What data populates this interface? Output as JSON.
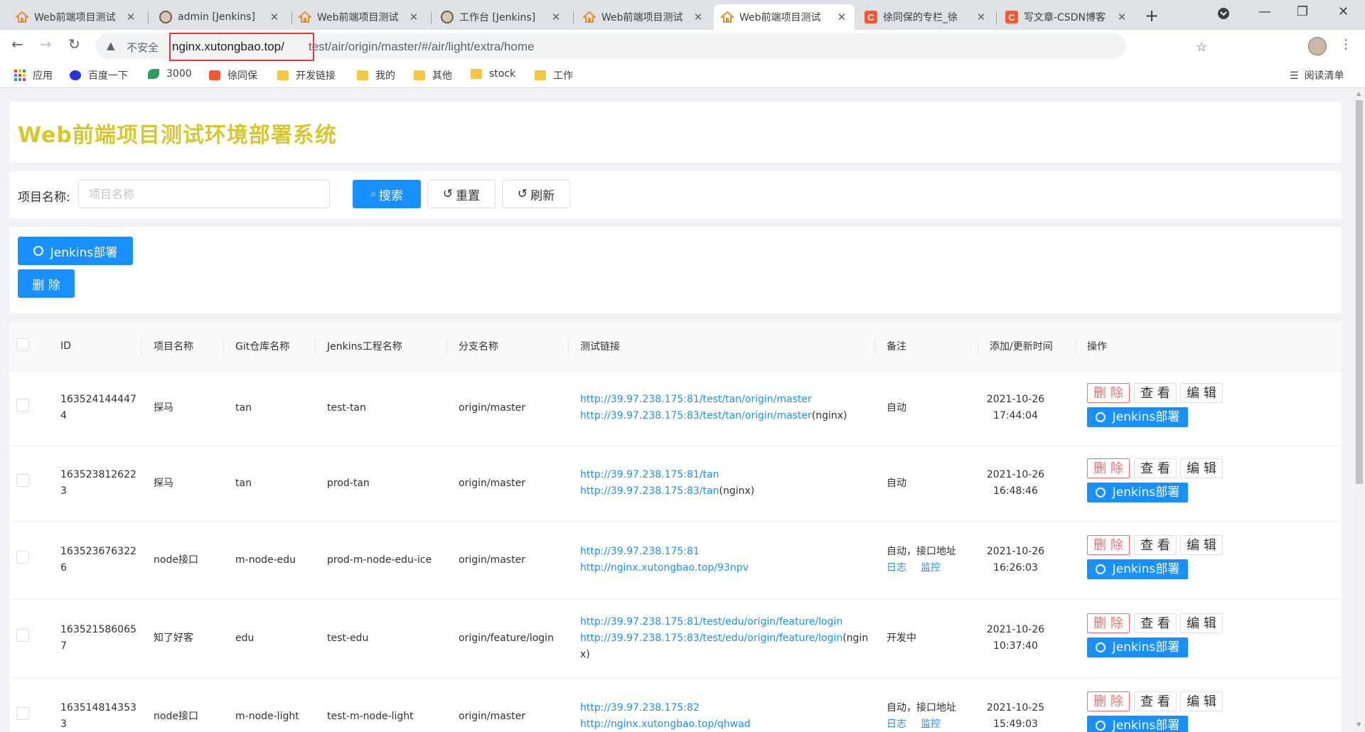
{
  "browser": {
    "tabs": [
      {
        "title": "Web前端项目测试",
        "icon": "web-project-icon",
        "active": false
      },
      {
        "title": "admin [Jenkins]",
        "icon": "jenkins-icon",
        "active": false
      },
      {
        "title": "Web前端项目测试",
        "icon": "web-project-icon",
        "active": false
      },
      {
        "title": "工作台 [Jenkins]",
        "icon": "jenkins-icon",
        "active": false
      },
      {
        "title": "Web前端项目测试",
        "icon": "web-project-icon",
        "active": false
      },
      {
        "title": "Web前端项目测试",
        "icon": "web-project-icon",
        "active": true
      },
      {
        "title": "徐同保的专栏_徐",
        "icon": "csdn-icon",
        "active": false
      },
      {
        "title": "写文章-CSDN博客",
        "icon": "csdn-icon",
        "active": false
      }
    ],
    "address": {
      "warning": "不安全",
      "host": "nginx.xutongbao.top/",
      "path": "test/air/origin/master/#/air/light/extra/home"
    },
    "bookmarks": [
      {
        "label": "应用",
        "icon": "apps-icon"
      },
      {
        "label": "百度一下",
        "icon": "baidu-icon"
      },
      {
        "label": "3000",
        "icon": "plant-icon"
      },
      {
        "label": "徐同保",
        "icon": "csdn-icon"
      },
      {
        "label": "开发链接",
        "icon": "folder-icon"
      },
      {
        "label": "我的",
        "icon": "folder-icon"
      },
      {
        "label": "其他",
        "icon": "folder-icon"
      },
      {
        "label": "stock",
        "icon": "folder-icon"
      },
      {
        "label": "工作",
        "icon": "folder-icon"
      }
    ],
    "reading_list": "阅读清单"
  },
  "page": {
    "title": "Web前端项目测试环境部署系统",
    "search": {
      "label": "项目名称:",
      "placeholder": "项目名称",
      "value": "",
      "search_btn": "搜索",
      "reset_btn": "重置",
      "refresh_btn": "刷新"
    },
    "actions": {
      "jenkins_btn": "Jenkins部署",
      "delete_btn": "删 除"
    },
    "table": {
      "columns": [
        "ID",
        "项目名称",
        "Git仓库名称",
        "Jenkins工程名称",
        "分支名称",
        "测试链接",
        "备注",
        "添加/更新时间",
        "操作"
      ],
      "rows": [
        {
          "id": "1635241444474",
          "project": "探马",
          "git": "tan",
          "jenkins": "test-tan",
          "branch": "origin/master",
          "link1": "http://39.97.238.175:81/test/tan/origin/master",
          "link2": "http://39.97.238.175:83/test/tan/origin/master",
          "link2_suffix": "(nginx)",
          "memo": "自动",
          "memo_links": [],
          "date": "2021-10-26",
          "time": "17:44:04"
        },
        {
          "id": "1635238126223",
          "project": "探马",
          "git": "tan",
          "jenkins": "prod-tan",
          "branch": "origin/master",
          "link1": "http://39.97.238.175:81/tan",
          "link2": "http://39.97.238.175:83/tan",
          "link2_suffix": "(nginx)",
          "memo": "自动",
          "memo_links": [],
          "date": "2021-10-26",
          "time": "16:48:46"
        },
        {
          "id": "1635236763226",
          "project": "node接口",
          "git": "m-node-edu",
          "jenkins": "prod-m-node-edu-ice",
          "branch": "origin/master",
          "link1": "http://39.97.238.175:81",
          "link2": "http://nginx.xutongbao.top/93npv",
          "link2_suffix": "",
          "memo": "自动，接口地址",
          "memo_links": [
            "日志",
            "监控"
          ],
          "date": "2021-10-26",
          "time": "16:26:03"
        },
        {
          "id": "1635215860657",
          "project": "知了好客",
          "git": "edu",
          "jenkins": "test-edu",
          "branch": "origin/feature/login",
          "link1": "http://39.97.238.175:81/test/edu/origin/feature/login",
          "link2": "http://39.97.238.175:83/test/edu/origin/feature/login",
          "link2_suffix": "(nginx)",
          "memo": "开发中",
          "memo_links": [],
          "date": "2021-10-26",
          "time": "10:37:40"
        },
        {
          "id": "1635148143533",
          "project": "node接口",
          "git": "m-node-light",
          "jenkins": "test-m-node-light",
          "branch": "origin/master",
          "link1": "http://39.97.238.175:82",
          "link2": "http://nginx.xutongbao.top/qhwad",
          "link2_suffix": "",
          "memo": "自动，接口地址",
          "memo_links": [
            "日志",
            "监控"
          ],
          "date": "2021-10-25",
          "time": "15:49:03"
        }
      ],
      "op_labels": {
        "delete": "删 除",
        "view": "查 看",
        "edit": "编 辑",
        "jenkins": "Jenkins部署"
      }
    }
  },
  "colors": {
    "title": "#d7c72c",
    "primary": "#1890ff",
    "danger": "#f56c6c",
    "highlight": "#e23a3a"
  }
}
